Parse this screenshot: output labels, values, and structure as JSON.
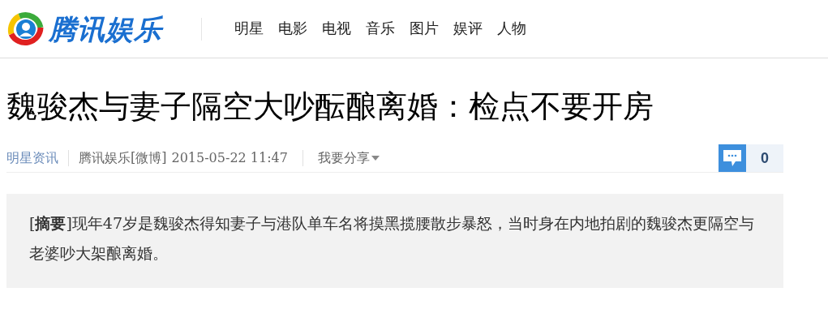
{
  "header": {
    "logo_text": "腾讯娱乐",
    "nav": [
      {
        "label": "明星"
      },
      {
        "label": "电影"
      },
      {
        "label": "电视"
      },
      {
        "label": "音乐"
      },
      {
        "label": "图片"
      },
      {
        "label": "娱评"
      },
      {
        "label": "人物"
      }
    ]
  },
  "article": {
    "title": "魏骏杰与妻子隔空大吵酝酿离婚：检点不要开房",
    "meta": {
      "category": "明星资讯",
      "source": "腾讯娱乐[微博]",
      "time": "2015-05-22 11:47",
      "share": "我要分享",
      "comment_count": "0"
    },
    "summary": "[**摘要**]现年47岁是魏骏杰得知妻子与港队单车名将摸黑揽腰散步暴怒，当时身在内地拍剧的魏骏杰更隔空与老婆吵大架酿离婚。"
  }
}
